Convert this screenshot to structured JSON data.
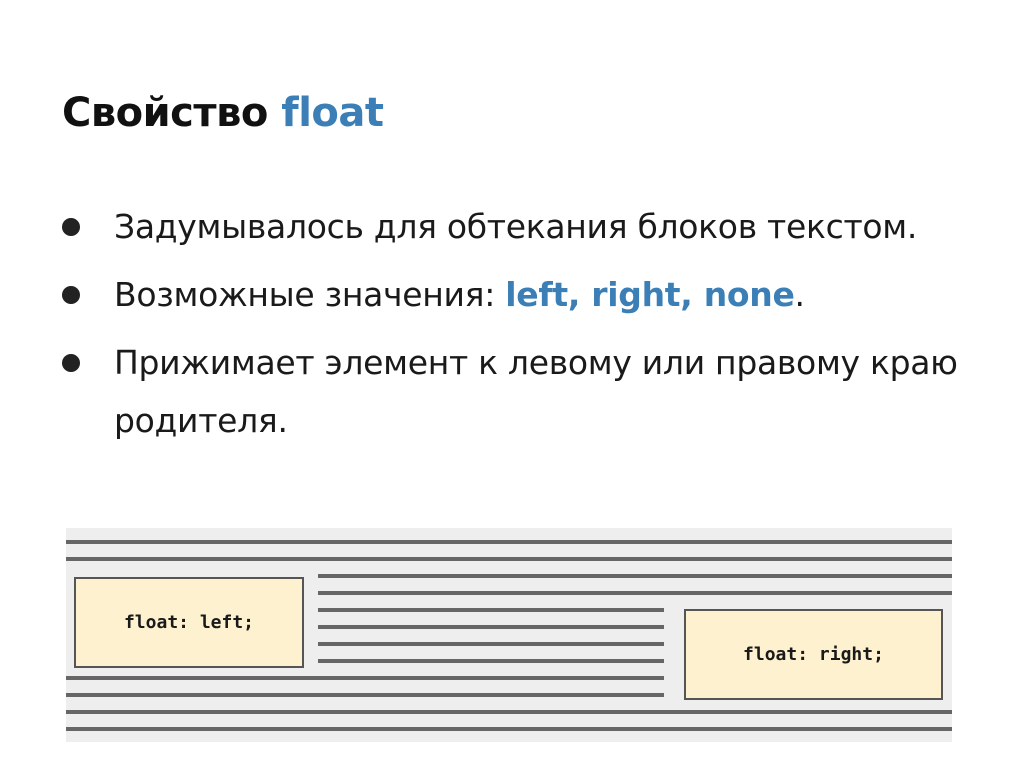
{
  "slide": {
    "title_prefix": "Свойство ",
    "title_accent": "float",
    "bullets": [
      {
        "text": "Задумывалось для обтекания блоков текстом."
      },
      {
        "text_before": "Возможные значения: ",
        "highlight": "left, right, none",
        "text_after": "."
      },
      {
        "text": "Прижимает элемент к левому или правому краю родителя."
      }
    ],
    "accent_color": "#3b7fb6"
  },
  "diagram": {
    "left_box_label": "float: left;",
    "right_box_label": "float: right;",
    "box_fill": "#fdf1cf",
    "line_color": "#666666"
  }
}
